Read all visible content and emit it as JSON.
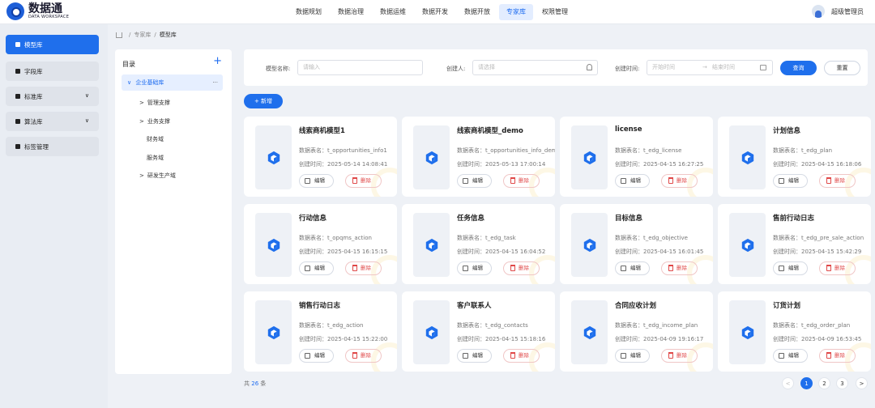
{
  "app": {
    "name": "数据通",
    "subtitle": "DATA WORKSPACE"
  },
  "nav": {
    "items": [
      {
        "label": "数据规划",
        "active": false
      },
      {
        "label": "数据治理",
        "active": false
      },
      {
        "label": "数据运维",
        "active": false
      },
      {
        "label": "数据开发",
        "active": false
      },
      {
        "label": "数据开放",
        "active": false
      },
      {
        "label": "专家库",
        "active": true
      },
      {
        "label": "权限管理",
        "active": false
      }
    ]
  },
  "user": {
    "name": "超级管理员",
    "avatar_icon": "user-avatar-icon"
  },
  "sidebar": {
    "items": [
      {
        "label": "模型库",
        "active": true,
        "expandable": false,
        "icon": "model-icon"
      },
      {
        "label": "字段库",
        "active": false,
        "expandable": false,
        "icon": "field-icon"
      },
      {
        "label": "标准库",
        "active": false,
        "expandable": true,
        "icon": "standard-icon"
      },
      {
        "label": "算法库",
        "active": false,
        "expandable": true,
        "icon": "algorithm-icon"
      },
      {
        "label": "标签管理",
        "active": false,
        "expandable": false,
        "icon": "tag-icon"
      }
    ]
  },
  "breadcrumb": {
    "items": [
      "专家库",
      "模型库"
    ],
    "separator": "/",
    "home_icon": "home-icon"
  },
  "tree": {
    "title": "目录",
    "add_symbol": "+",
    "selected": {
      "label": "企业基础库",
      "toggle": "∨",
      "more": "···"
    },
    "children": [
      {
        "label": "管理支撑",
        "toggle": ">"
      },
      {
        "label": "业务支撑",
        "toggle": ">"
      },
      {
        "label": "财务域",
        "toggle": ""
      },
      {
        "label": "服务域",
        "toggle": ""
      },
      {
        "label": "研发生产域",
        "toggle": ">"
      }
    ]
  },
  "filters": {
    "model_name": {
      "label": "模型名称:",
      "placeholder": "请输入"
    },
    "creator": {
      "label": "创建人:",
      "placeholder": "请选择"
    },
    "created_time": {
      "label": "创建时间:",
      "start_placeholder": "开始时间",
      "arrow": "→",
      "end_placeholder": "结束时间"
    },
    "search_label": "查询",
    "reset_label": "重置"
  },
  "add_button": {
    "label": "+ 新增"
  },
  "card_labels": {
    "table_prefix": "数据表名：",
    "time_prefix": "创建时间：",
    "edit": "编辑",
    "delete": "删除"
  },
  "cards": [
    {
      "title": "线索商机模型1",
      "table": "t_opportunities_info1",
      "time": "2025-05-14 14:08:41"
    },
    {
      "title": "线索商机模型_demo",
      "table": "t_opportunities_info_demo",
      "time": "2025-05-13 17:00:14"
    },
    {
      "title": "license",
      "table": "t_edg_license",
      "time": "2025-04-15 16:27:25"
    },
    {
      "title": "计划信息",
      "table": "t_edg_plan",
      "time": "2025-04-15 16:18:06"
    },
    {
      "title": "行动信息",
      "table": "t_opqms_action",
      "time": "2025-04-15 16:15:15"
    },
    {
      "title": "任务信息",
      "table": "t_edg_task",
      "time": "2025-04-15 16:04:52"
    },
    {
      "title": "目标信息",
      "table": "t_edg_objective",
      "time": "2025-04-15 16:01:45"
    },
    {
      "title": "售前行动日志",
      "table": "t_edg_pre_sale_action",
      "time": "2025-04-15 15:42:29"
    },
    {
      "title": "销售行动日志",
      "table": "t_edg_action",
      "time": "2025-04-15 15:22:00"
    },
    {
      "title": "客户联系人",
      "table": "t_edg_contacts",
      "time": "2025-04-15 15:18:16"
    },
    {
      "title": "合同应收计划",
      "table": "t_edg_income_plan",
      "time": "2025-04-09 19:16:17"
    },
    {
      "title": "订货计划",
      "table": "t_edg_order_plan",
      "time": "2025-04-09 16:53:45"
    }
  ],
  "pagination": {
    "total_prefix": "共",
    "total": "26",
    "total_suffix": "条",
    "prev": "<",
    "next": ">",
    "pages": [
      "1",
      "2",
      "3"
    ],
    "current": "1"
  },
  "colors": {
    "primary": "#1f6fec",
    "danger": "#e04848",
    "sidebar_bg": "#e9edf3"
  }
}
